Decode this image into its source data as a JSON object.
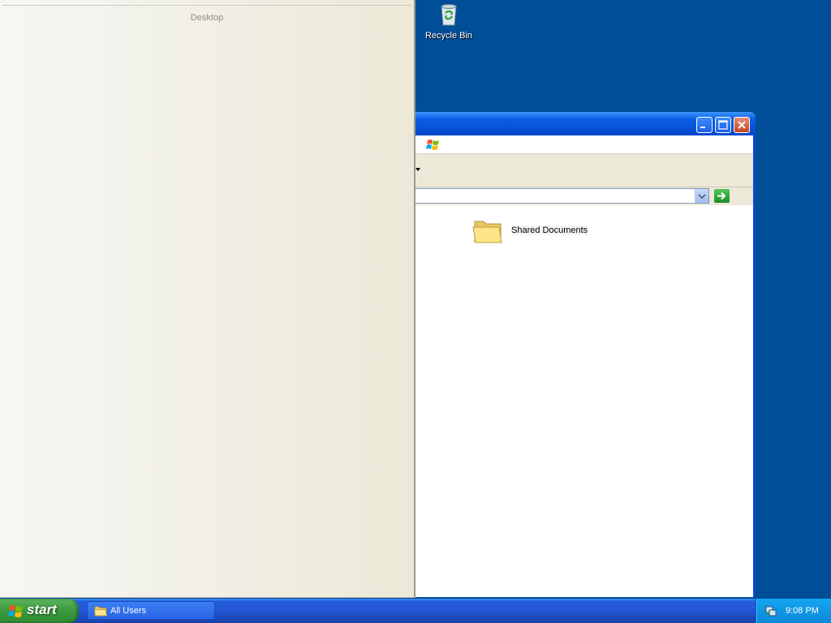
{
  "desktop": {
    "background_color": "#004e98",
    "icons": [
      {
        "label": "Recycle Bin",
        "icon": "recycle-bin-icon"
      }
    ]
  },
  "left_panel": {
    "title": "Desktop"
  },
  "explorer": {
    "title_buttons": [
      "minimize-icon",
      "maximize-icon",
      "close-icon"
    ],
    "address": {
      "value": ""
    },
    "items": [
      {
        "label": "Shared Documents",
        "icon": "folder-icon"
      }
    ]
  },
  "taskbar": {
    "start_label": "start",
    "tasks": [
      {
        "label": "All Users",
        "icon": "folder-icon"
      }
    ],
    "clock": "9:08 PM"
  },
  "colors": {
    "taskbar_blue": "#245edb",
    "start_green": "#3c9b3e",
    "tray_blue": "#0c88d9",
    "titlebar_blue": "#0a5fe6"
  }
}
